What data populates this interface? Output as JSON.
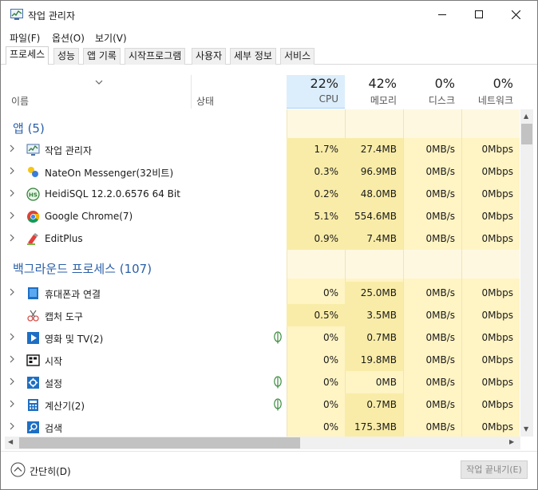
{
  "window": {
    "title": "작업 관리자",
    "controls": [
      "minimize",
      "maximize",
      "close"
    ]
  },
  "menu": [
    "파일(F)",
    "옵션(O)",
    "보기(V)"
  ],
  "tabs": [
    "프로세스",
    "성능",
    "앱 기록",
    "시작프로그램",
    "사용자",
    "세부 정보",
    "서비스"
  ],
  "active_tab": "프로세스",
  "columns": {
    "name": "이름",
    "status": "상태",
    "cpu": {
      "percent": "22%",
      "label": "CPU"
    },
    "memory": {
      "percent": "42%",
      "label": "메모리"
    },
    "disk": {
      "percent": "0%",
      "label": "디스크"
    },
    "network": {
      "percent": "0%",
      "label": "네트워크"
    }
  },
  "groups": {
    "apps": "앱 (5)",
    "background": "백그라운드 프로세스 (107)"
  },
  "apps": [
    {
      "name": "작업 관리자",
      "icon": "task-manager-icon",
      "expandable": true,
      "cpu": "1.7%",
      "memory": "27.4MB",
      "disk": "0MB/s",
      "network": "0Mbps"
    },
    {
      "name": "NateOn Messenger(32비트)",
      "icon": "nateon-icon",
      "expandable": true,
      "cpu": "0.3%",
      "memory": "96.9MB",
      "disk": "0MB/s",
      "network": "0Mbps"
    },
    {
      "name": "HeidiSQL 12.2.0.6576 64 Bit",
      "icon": "heidisql-icon",
      "expandable": true,
      "cpu": "0.2%",
      "memory": "48.0MB",
      "disk": "0MB/s",
      "network": "0Mbps"
    },
    {
      "name": "Google Chrome(7)",
      "icon": "chrome-icon",
      "expandable": true,
      "cpu": "5.1%",
      "memory": "554.6MB",
      "disk": "0MB/s",
      "network": "0Mbps"
    },
    {
      "name": "EditPlus",
      "icon": "editplus-icon",
      "expandable": true,
      "cpu": "0.9%",
      "memory": "7.4MB",
      "disk": "0MB/s",
      "network": "0Mbps"
    }
  ],
  "background": [
    {
      "name": "휴대폰과 연결",
      "icon": "phone-link-icon",
      "expandable": true,
      "suspended": false,
      "cpu": "0%",
      "memory": "25.0MB",
      "disk": "0MB/s",
      "network": "0Mbps"
    },
    {
      "name": "캡처 도구",
      "icon": "snipping-tool-icon",
      "expandable": false,
      "suspended": false,
      "cpu": "0.5%",
      "memory": "3.5MB",
      "disk": "0MB/s",
      "network": "0Mbps"
    },
    {
      "name": "영화 및 TV(2)",
      "icon": "movies-tv-icon",
      "expandable": true,
      "suspended": true,
      "cpu": "0%",
      "memory": "0.7MB",
      "disk": "0MB/s",
      "network": "0Mbps"
    },
    {
      "name": "시작",
      "icon": "start-icon",
      "expandable": true,
      "suspended": false,
      "cpu": "0%",
      "memory": "19.8MB",
      "disk": "0MB/s",
      "network": "0Mbps"
    },
    {
      "name": "설정",
      "icon": "settings-gear-icon",
      "expandable": true,
      "suspended": true,
      "cpu": "0%",
      "memory": "0MB",
      "disk": "0MB/s",
      "network": "0Mbps"
    },
    {
      "name": "계산기(2)",
      "icon": "calculator-icon",
      "expandable": true,
      "suspended": true,
      "cpu": "0%",
      "memory": "0.7MB",
      "disk": "0MB/s",
      "network": "0Mbps"
    },
    {
      "name": "검색",
      "icon": "search-icon",
      "expandable": true,
      "suspended": false,
      "cpu": "0%",
      "memory": "175.3MB",
      "disk": "0MB/s",
      "network": "0Mbps"
    }
  ],
  "footer": {
    "collapse_label": "간단히(D)",
    "end_task_label": "작업 끝내기(E)"
  },
  "colors": {
    "group_text": "#2a5fa8",
    "cpu_header_bg": "#dceefb",
    "heat_light": "#fff4c4",
    "heat_medium": "#f9eca8",
    "heat_group": "#fff8e1"
  }
}
